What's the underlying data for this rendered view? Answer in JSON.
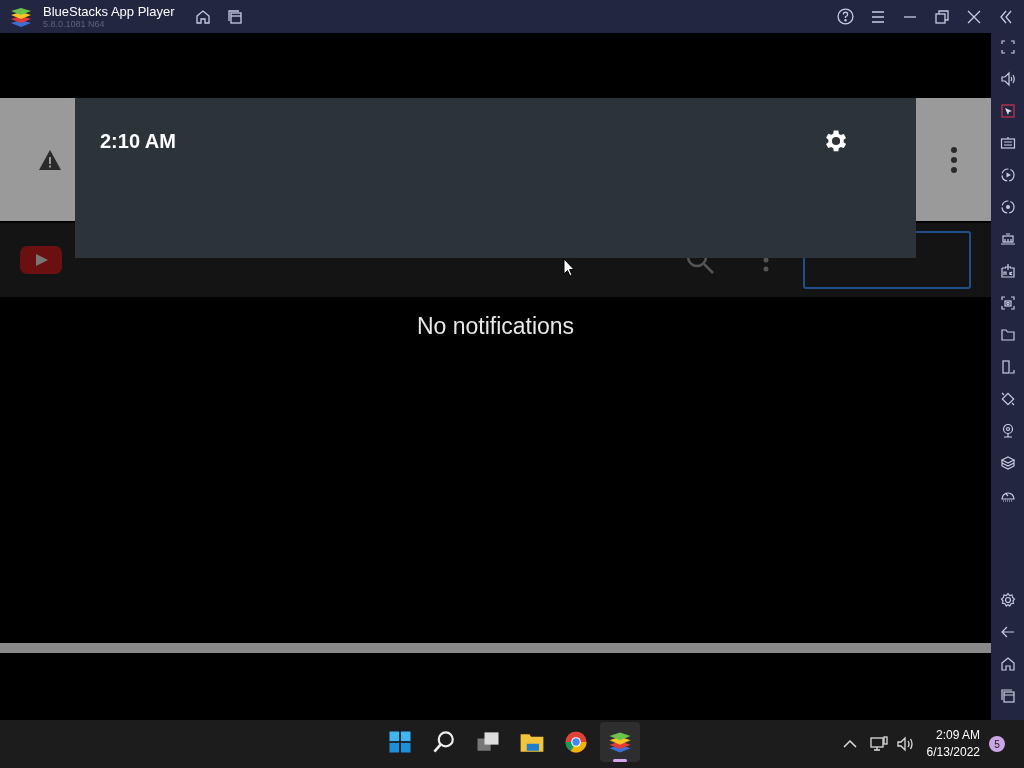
{
  "window": {
    "title": "BlueStacks App Player",
    "version": "5.8.0.1081 N64"
  },
  "notification_shade": {
    "time": "2:10 AM",
    "empty_message": "No notifications"
  },
  "taskbar": {
    "apps": [
      {
        "selected": false
      },
      {
        "selected": false
      },
      {
        "selected": false
      },
      {
        "selected": false
      },
      {
        "selected": false
      },
      {
        "selected": true
      }
    ],
    "time": "2:09 AM",
    "date": "6/13/2022",
    "notification_count": "5"
  }
}
